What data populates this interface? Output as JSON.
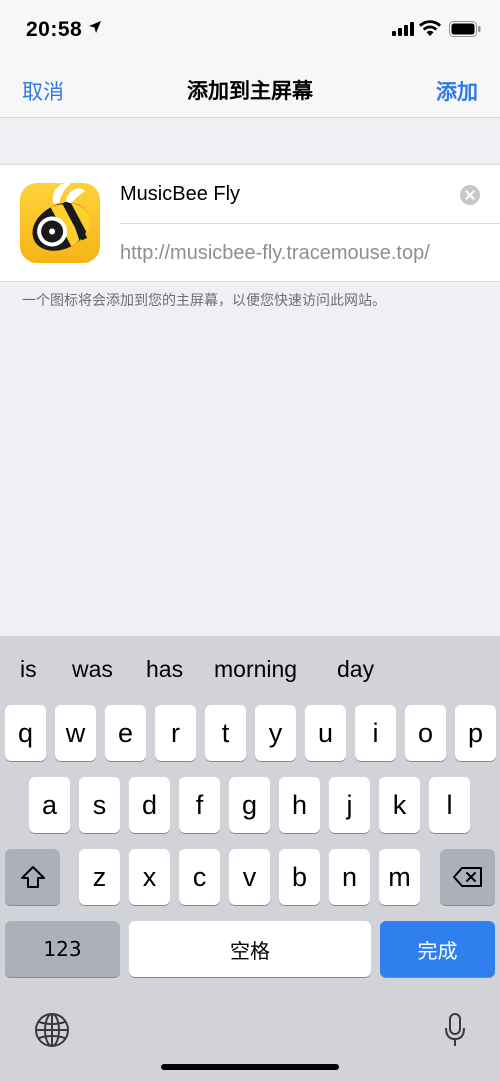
{
  "status": {
    "time": "20:58"
  },
  "nav": {
    "cancel": "取消",
    "title": "添加到主屏幕",
    "add": "添加"
  },
  "card": {
    "name_value": "MusicBee Fly",
    "url": "http://musicbee-fly.tracemouse.top/"
  },
  "hint": "一个图标将会添加到您的主屏幕，以便您快速访问此网站。",
  "keyboard": {
    "suggestions": [
      "is",
      "was",
      "has",
      "morning",
      "day"
    ],
    "row1": [
      "q",
      "w",
      "e",
      "r",
      "t",
      "y",
      "u",
      "i",
      "o",
      "p"
    ],
    "row2": [
      "a",
      "s",
      "d",
      "f",
      "g",
      "h",
      "j",
      "k",
      "l"
    ],
    "row3": [
      "z",
      "x",
      "c",
      "v",
      "b",
      "n",
      "m"
    ],
    "numbers_label": "123",
    "space_label": "空格",
    "done_label": "完成"
  },
  "colors": {
    "accent": "#2f7ae5",
    "done_key": "#2f7fef",
    "icon_yellow": "#f5b417"
  },
  "icons": [
    "location-arrow-icon",
    "cellular-signal-icon",
    "wifi-icon",
    "battery-icon",
    "clear-icon",
    "shift-icon",
    "backspace-icon",
    "globe-icon",
    "microphone-icon",
    "musicbee-app-icon"
  ]
}
